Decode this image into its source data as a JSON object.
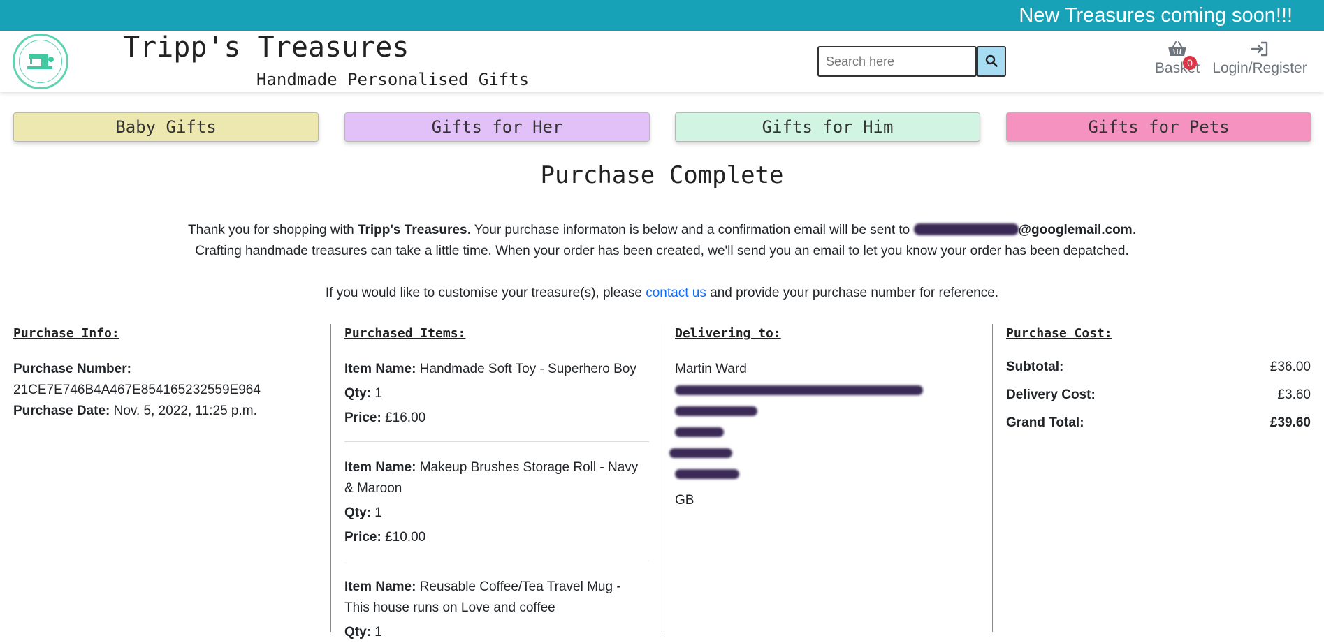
{
  "banner": {
    "text": "New Treasures coming soon!!!"
  },
  "header": {
    "logo_alt": "Tripp's Treasures",
    "title": "Tripp's Treasures",
    "subtitle": "Handmade Personalised Gifts",
    "search": {
      "placeholder": "Search here"
    },
    "basket": {
      "label": "Basket",
      "count": "0",
      "icon": "basket-icon"
    },
    "login": {
      "label": "Login/Register",
      "icon": "sign-in-icon"
    }
  },
  "categories": [
    {
      "label": "Baby Gifts",
      "color": "#ede8b0"
    },
    {
      "label": "Gifts for Her",
      "color": "#e2c0f8"
    },
    {
      "label": "Gifts for Him",
      "color": "#d2f4e2"
    },
    {
      "label": "Gifts for Pets",
      "color": "#f592c0"
    }
  ],
  "page_title": "Purchase Complete",
  "intro": {
    "p1_a": "Thank you for shopping with ",
    "p1_brand": "Tripp's Treasures",
    "p1_b": ". Your purchase informaton is below and a confirmation email will be sent to ",
    "p1_email_domain": "@googlemail.com",
    "p1_end": ".",
    "p2": "Crafting handmade treasures can take a little time. When your order has been created, we'll send you an email to let you know your order has been depatched.",
    "p3_a": "If you would like to customise your treasure(s), please ",
    "p3_link": "contact us",
    "p3_b": " and provide your purchase number for reference."
  },
  "purchase_info": {
    "heading": "Purchase Info:",
    "number_label": "Purchase Number:",
    "number": "21CE7E746B4A467E854165232559E964",
    "date_label": "Purchase Date:",
    "date": "Nov. 5, 2022, 11:25 p.m."
  },
  "purchased_items": {
    "heading": "Purchased Items:",
    "name_label": "Item Name:",
    "qty_label": "Qty:",
    "price_label": "Price:",
    "items": [
      {
        "name": "Handmade Soft Toy - Superhero Boy",
        "qty": "1",
        "price": "£16.00"
      },
      {
        "name": "Makeup Brushes Storage Roll - Navy & Maroon",
        "qty": "1",
        "price": "£10.00"
      },
      {
        "name": "Reusable Coffee/Tea Travel Mug - This house runs on Love and coffee",
        "qty": "1",
        "price": ""
      }
    ]
  },
  "delivering_to": {
    "heading": "Delivering to:",
    "name": "Martin Ward",
    "country": "GB"
  },
  "purchase_cost": {
    "heading": "Purchase Cost:",
    "subtotal_label": "Subtotal:",
    "subtotal": "£36.00",
    "delivery_label": "Delivery Cost:",
    "delivery": "£3.60",
    "total_label": "Grand Total:",
    "total": "£39.60"
  }
}
